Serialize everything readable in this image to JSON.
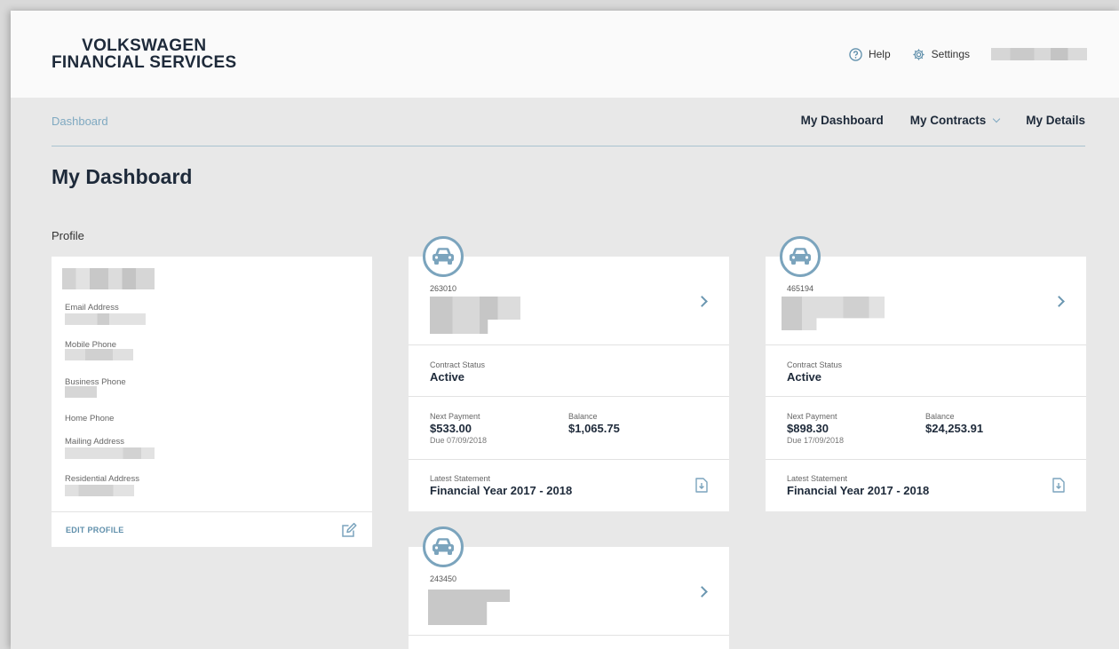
{
  "header": {
    "logo_line1": "VOLKSWAGEN",
    "logo_line2": "FINANCIAL SERVICES",
    "help_label": "Help",
    "settings_label": "Settings"
  },
  "nav": {
    "breadcrumb": "Dashboard",
    "items": [
      {
        "label": "My Dashboard"
      },
      {
        "label": "My Contracts",
        "has_dropdown": true
      },
      {
        "label": "My Details"
      }
    ]
  },
  "page": {
    "title": "My Dashboard",
    "profile_section_label": "Profile"
  },
  "profile": {
    "fields": [
      {
        "label": "Email Address"
      },
      {
        "label": "Mobile Phone"
      },
      {
        "label": "Business Phone"
      },
      {
        "label": "Home Phone"
      },
      {
        "label": "Mailing Address"
      },
      {
        "label": "Residential Address"
      }
    ],
    "edit_label": "EDIT PROFILE"
  },
  "contracts": [
    {
      "number": "263010",
      "status_label": "Contract Status",
      "status": "Active",
      "next_payment_label": "Next Payment",
      "next_payment": "$533.00",
      "due": "Due 07/09/2018",
      "balance_label": "Balance",
      "balance": "$1,065.75",
      "statement_label": "Latest Statement",
      "statement": "Financial Year 2017 - 2018"
    },
    {
      "number": "465194",
      "status_label": "Contract Status",
      "status": "Active",
      "next_payment_label": "Next Payment",
      "next_payment": "$898.30",
      "due": "Due 17/09/2018",
      "balance_label": "Balance",
      "balance": "$24,253.91",
      "statement_label": "Latest Statement",
      "statement": "Financial Year 2017 - 2018"
    },
    {
      "number": "243450"
    }
  ],
  "colors": {
    "accent": "#7ba4bd",
    "text_dark": "#1e2a3a",
    "background": "#e8e8e8"
  }
}
